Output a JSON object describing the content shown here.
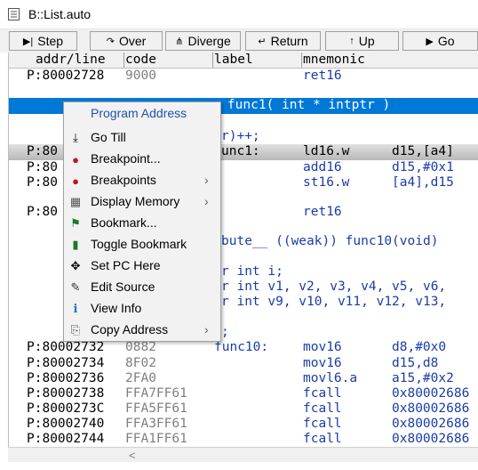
{
  "window": {
    "title": "B::List.auto"
  },
  "toolbar": [
    {
      "label": "Step",
      "icon": "step-icon",
      "glyph": "▶|"
    },
    {
      "label": "Over",
      "icon": "over-icon",
      "glyph": "↷"
    },
    {
      "label": "Diverge",
      "icon": "diverge-icon",
      "glyph": "⋔"
    },
    {
      "label": "Return",
      "icon": "return-icon",
      "glyph": "↵"
    },
    {
      "label": "Up",
      "icon": "up-icon",
      "glyph": "↑"
    },
    {
      "label": "Go",
      "icon": "go-icon",
      "glyph": "▶"
    }
  ],
  "columns": {
    "addr": "addr/line",
    "code": "code",
    "label": "label",
    "mnemonic": "mnemonic"
  },
  "rows": [
    {
      "addr": "P:80002728",
      "code": "9000",
      "label": "",
      "mnem": "ret16",
      "ops": ""
    },
    {
      "selected_source": "    func1( int * intptr )"
    },
    {
      "source_tail": "r)++;"
    },
    {
      "addr": "P:80",
      "code": "unc1:",
      "label": "",
      "mnem": "ld16.w",
      "ops": "d15,[a4]"
    },
    {
      "addr": "P:80",
      "code": "",
      "label": "",
      "mnem": "add16",
      "ops": "d15,#0x1"
    },
    {
      "addr": "P:80",
      "code": "",
      "label": "",
      "mnem": "st16.w",
      "ops": "[a4],d15"
    },
    {
      "addr": "P:80",
      "code": "",
      "label": "",
      "mnem": "ret16",
      "ops": ""
    },
    {
      "source_tail": "bute__ ((weak)) func10(void)"
    },
    {
      "source_tail": "r int i;"
    },
    {
      "source_tail": "r int v1, v2, v3, v4, v5, v6,"
    },
    {
      "source_tail": "r int v9, v10, v11, v12, v13,"
    },
    {
      "source_tail": ";"
    },
    {
      "addr": "P:80002732",
      "code": "0882",
      "label": "func10:",
      "mnem": "mov16",
      "ops": "d8,#0x0"
    },
    {
      "addr": "P:80002734",
      "code": "8F02",
      "label": "",
      "mnem": "mov16",
      "ops": "d15,d8"
    },
    {
      "addr": "P:80002736",
      "code": "2FA0",
      "label": "",
      "mnem": "movl6.a",
      "ops": "a15,#0x2"
    },
    {
      "addr": "P:80002738",
      "code": "FFA7FF61",
      "label": "",
      "mnem": "fcall",
      "ops": "0x80002686"
    },
    {
      "addr": "P:8000273C",
      "code": "FFA5FF61",
      "label": "",
      "mnem": "fcall",
      "ops": "0x80002686"
    },
    {
      "addr": "P:80002740",
      "code": "FFA3FF61",
      "label": "",
      "mnem": "fcall",
      "ops": "0x80002686"
    },
    {
      "addr": "P:80002744",
      "code": "FFA1FF61",
      "label": "",
      "mnem": "fcall",
      "ops": "0x80002686"
    }
  ],
  "context_menu": {
    "title": "Program Address",
    "items": [
      {
        "label": "Go Till",
        "icon": "download-arrow-icon",
        "glyph": "⤓",
        "submenu": false
      },
      {
        "label": "Breakpoint...",
        "icon": "breakpoint-icon",
        "glyph": "●",
        "submenu": false
      },
      {
        "label": "Breakpoints",
        "icon": "breakpoints-icon",
        "glyph": "●",
        "submenu": true
      },
      {
        "label": "Display Memory",
        "icon": "memory-icon",
        "glyph": "▦",
        "submenu": true
      },
      {
        "label": "Bookmark...",
        "icon": "bookmark-flag-icon",
        "glyph": "⚑",
        "submenu": false
      },
      {
        "label": "Toggle Bookmark",
        "icon": "bookmark-icon",
        "glyph": "▮",
        "submenu": false
      },
      {
        "label": "Set PC Here",
        "icon": "move-cross-icon",
        "glyph": "✥",
        "submenu": false
      },
      {
        "label": "Edit Source",
        "icon": "edit-icon",
        "glyph": "✎",
        "submenu": false
      },
      {
        "label": "View Info",
        "icon": "info-icon",
        "glyph": "i",
        "submenu": false
      },
      {
        "label": "Copy Address",
        "icon": "copy-icon",
        "glyph": "⎘",
        "submenu": true
      }
    ]
  },
  "colors": {
    "selection": "#0078d7",
    "menu_bg": "#f2f2f2",
    "code_blue": "#1a3ca8",
    "accent_red": "#b01818"
  }
}
